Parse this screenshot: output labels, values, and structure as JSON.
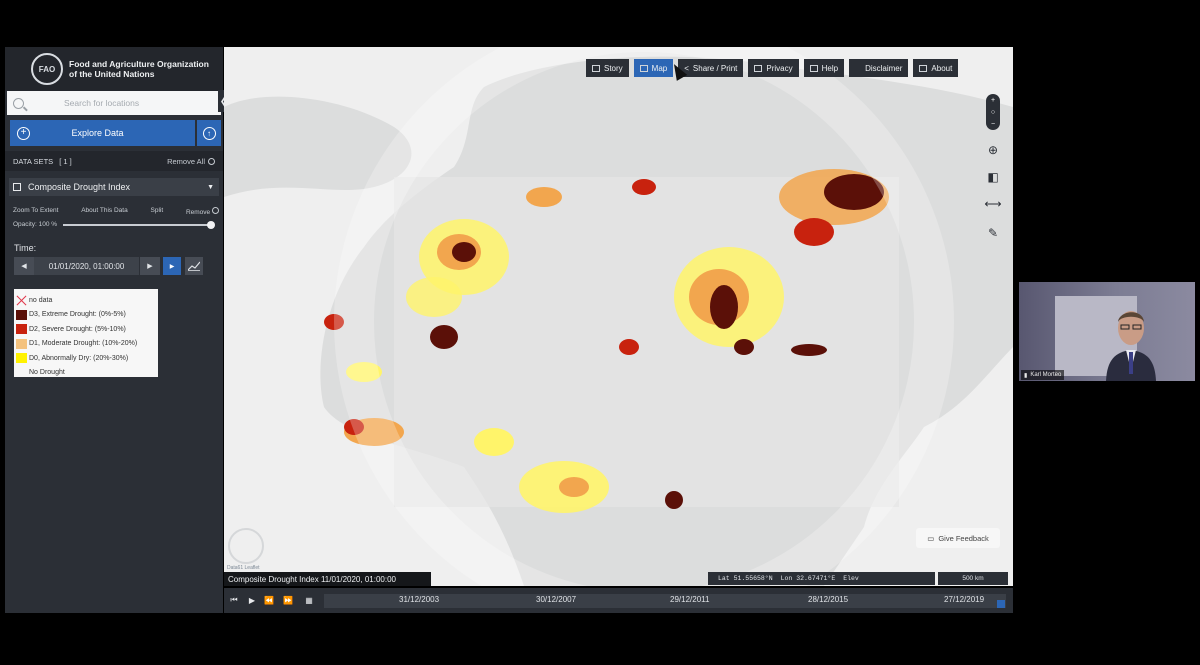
{
  "org": {
    "logo_text": "FAO",
    "name_line1": "Food and Agriculture Organization",
    "name_line2": "of the United Nations"
  },
  "search": {
    "placeholder": "Search for locations"
  },
  "explore_label": "Explore Data",
  "datasets": {
    "label": "DATA SETS",
    "count": "[ 1 ]",
    "remove_all": "Remove All"
  },
  "layer": {
    "name": "Composite Drought Index",
    "actions": [
      "Zoom To Extent",
      "About This Data",
      "Split",
      "Remove"
    ],
    "opacity_label": "Opacity: 100 %",
    "opacity_value": 1.0
  },
  "time": {
    "label": "Time:",
    "value": "01/01/2020, 01:00:00"
  },
  "legend": [
    {
      "label": "no data",
      "color": "none"
    },
    {
      "label": "D3, Extreme Drought: (0%-5%)",
      "color": "#5b1008"
    },
    {
      "label": "D2, Severe Drought: (5%-10%)",
      "color": "#c8220e"
    },
    {
      "label": "D1, Moderate Drought: (10%-20%)",
      "color": "#f4c27e"
    },
    {
      "label": "D0, Abnormally Dry: (20%-30%)",
      "color": "#fff200"
    },
    {
      "label": "No Drought",
      "color": "none"
    }
  ],
  "toolbar": [
    "Story",
    "Map",
    "Share / Print",
    "Privacy",
    "Help",
    "Disclaimer",
    "About"
  ],
  "toolbar_active": "Map",
  "feedback": "Give Feedback",
  "attribution": "Data61  Leaflet",
  "coords": {
    "lat": "Lat 51.55658°N",
    "lon": "Lon 32.67471°E",
    "elev": "Elev"
  },
  "scale": "500 km",
  "caption": "Composite Drought Index 11/01/2020, 01:00:00",
  "timeline_labels": [
    "31/12/2003",
    "30/12/2007",
    "29/12/2011",
    "28/12/2015",
    "27/12/2019"
  ],
  "video": {
    "participant": "Karl Morteo"
  },
  "colors": {
    "accent": "#2c66b5",
    "panel": "#2b2f36",
    "extreme": "#5b1008",
    "severe": "#c8220e",
    "moderate": "#f4c27e",
    "dry": "#fff200"
  }
}
